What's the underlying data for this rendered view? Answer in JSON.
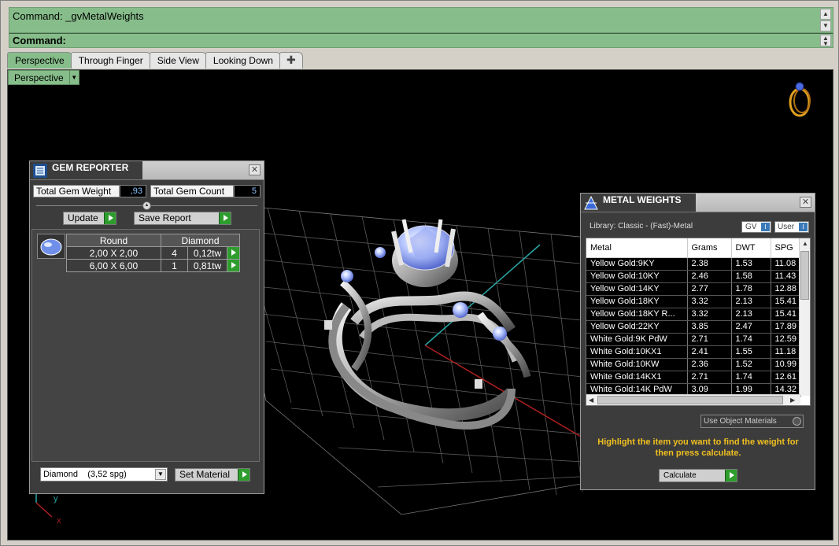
{
  "command": {
    "history": "Command: _gvMetalWeights",
    "prompt": "Command:"
  },
  "tabs": [
    "Perspective",
    "Through Finger",
    "Side View",
    "Looking Down"
  ],
  "viewport": {
    "title": "Perspective"
  },
  "gem_reporter": {
    "title": "GEM REPORTER",
    "total_weight_label": "Total Gem Weight",
    "total_weight_value": ",93",
    "total_count_label": "Total Gem Count",
    "total_count_value": "5",
    "update_label": "Update",
    "save_report_label": "Save Report",
    "table_headers": [
      "Round",
      "Diamond"
    ],
    "rows": [
      {
        "size": "2,00 X 2,00",
        "count": "4",
        "weight": "0,12tw"
      },
      {
        "size": "6,00 X 6,00",
        "count": "1",
        "weight": "0,81tw"
      }
    ],
    "material_select": "Diamond    (3,52 spg)",
    "set_material_label": "Set Material"
  },
  "metal_weights": {
    "title": "METAL WEIGHTS",
    "library": "Library: Classic - (Fast)-Metal",
    "gv_label": "GV",
    "user_label": "User",
    "columns": [
      "Metal",
      "Grams",
      "DWT",
      "SPG"
    ],
    "rows": [
      [
        "Yellow Gold:9KY",
        "2.38",
        "1.53",
        "11.08"
      ],
      [
        "Yellow Gold:10KY",
        "2.46",
        "1.58",
        "11.43"
      ],
      [
        "Yellow Gold:14KY",
        "2.77",
        "1.78",
        "12.88"
      ],
      [
        "Yellow Gold:18KY",
        "3.32",
        "2.13",
        "15.41"
      ],
      [
        "Yellow Gold:18KY R...",
        "3.32",
        "2.13",
        "15.41"
      ],
      [
        "Yellow Gold:22KY",
        "3.85",
        "2.47",
        "17.89"
      ],
      [
        "White Gold:9K PdW",
        "2.71",
        "1.74",
        "12.59"
      ],
      [
        "White Gold:10KX1",
        "2.41",
        "1.55",
        "11.18"
      ],
      [
        "White Gold:10KW",
        "2.36",
        "1.52",
        "10.99"
      ],
      [
        "White Gold:14KX1",
        "2.71",
        "1.74",
        "12.61"
      ],
      [
        "White Gold:14K PdW",
        "3.09",
        "1.99",
        "14.32"
      ]
    ],
    "use_object_materials": "Use Object Materials",
    "instruction": "Highlight the item you want to find the weight for then press calculate.",
    "calculate_label": "Calculate"
  },
  "axis": {
    "y": "y",
    "x": "x"
  }
}
